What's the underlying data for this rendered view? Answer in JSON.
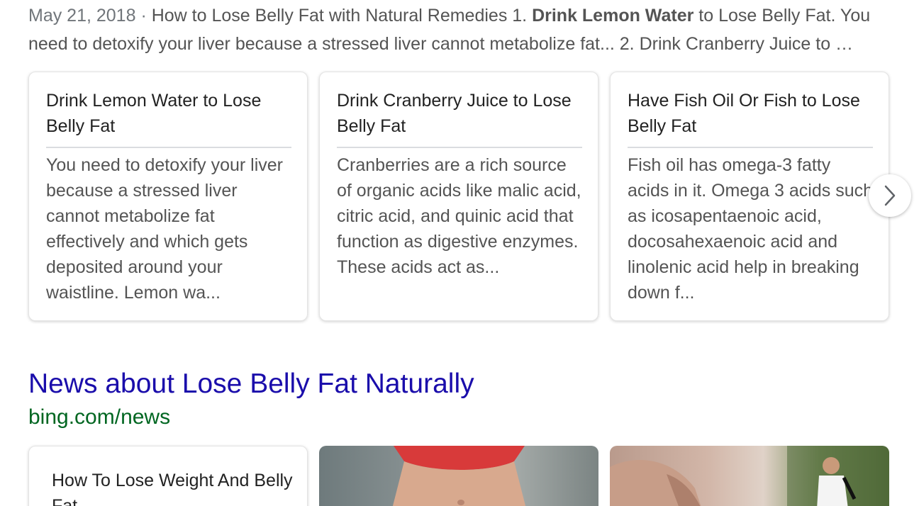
{
  "snippet": {
    "date": "May 21, 2018",
    "separator": " · ",
    "text_part1": "How to Lose Belly Fat with Natural Remedies 1. ",
    "bold": "Drink Lemon Water",
    "text_part2": " to Lose Belly Fat. You need to detoxify your liver because a stressed liver cannot metabolize fat... 2. Drink Cranberry Juice to …"
  },
  "cards": [
    {
      "title": "Drink Lemon Water to Lose Belly Fat",
      "body": "You need to detoxify your liver because a stressed liver cannot metabolize fat effectively and which gets deposited around your waistline. Lemon wa..."
    },
    {
      "title": "Drink Cranberry Juice to Lose Belly Fat",
      "body": "Cranberries are a rich source of organic acids like malic acid, citric acid, and quinic acid that function as digestive enzymes. These acids act as..."
    },
    {
      "title": "Have Fish Oil Or Fish to Lose Belly Fat",
      "body": "Fish oil has omega-3 fatty acids in it. Omega 3 acids such as icosapentaenoic acid, docosahexaenoic acid and linolenic acid help in breaking down f..."
    }
  ],
  "carousel": {
    "next_icon": "chevron-right-icon"
  },
  "news": {
    "heading": "News about Lose Belly Fat Naturally",
    "url": "bing.com/news",
    "items": [
      {
        "title": "How To Lose Weight And Belly Fat"
      }
    ]
  },
  "colors": {
    "link": "#1a0dab",
    "url": "#006621",
    "text": "#545454"
  }
}
